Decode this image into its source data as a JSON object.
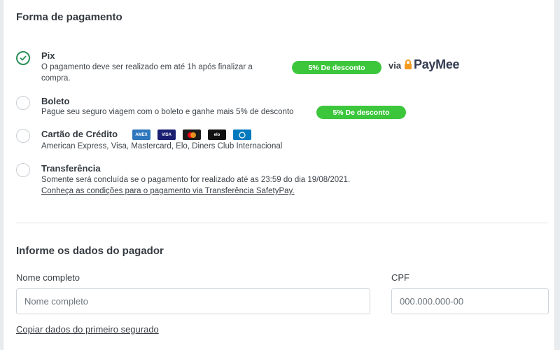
{
  "payment_section": {
    "title": "Forma de pagamento",
    "options": [
      {
        "id": "pix",
        "title": "Pix",
        "selected": true,
        "description_line1": "O pagamento deve ser realizado em até 1h após finalizar a",
        "description_line2": "compra.",
        "badge": "5% De desconto",
        "via_label": "via",
        "provider_logo": "PayMee"
      },
      {
        "id": "boleto",
        "title": "Boleto",
        "selected": false,
        "description": "Pague seu seguro viagem com o boleto e ganhe mais 5% de desconto",
        "badge": "5% De desconto"
      },
      {
        "id": "cartao",
        "title": "Cartão de Crédito",
        "selected": false,
        "description": "American Express, Visa, Mastercard, Elo, Diners Club Internacional",
        "card_icons": [
          "amex-icon",
          "visa-icon",
          "mastercard-icon",
          "elo-icon",
          "diners-club-icon"
        ]
      },
      {
        "id": "transferencia",
        "title": "Transferência",
        "selected": false,
        "description": "Somente será concluída se o pagamento for realizado até as 23:59 do dia 19/08/2021.",
        "link": "Conheça as condições para o pagamento via Transferência SafetyPay."
      }
    ]
  },
  "payer_section": {
    "title": "Informe os dados do pagador",
    "name_label": "Nome completo",
    "name_placeholder": "Nome completo",
    "name_value": "",
    "cpf_label": "CPF",
    "cpf_placeholder": "000.000.000-00",
    "cpf_value": "",
    "copy_link": "Copiar dados do primeiro segurado"
  },
  "colors": {
    "badge_green": "#3cc63c",
    "check_green": "#2a8f58",
    "page_bg": "#e9ecef"
  }
}
